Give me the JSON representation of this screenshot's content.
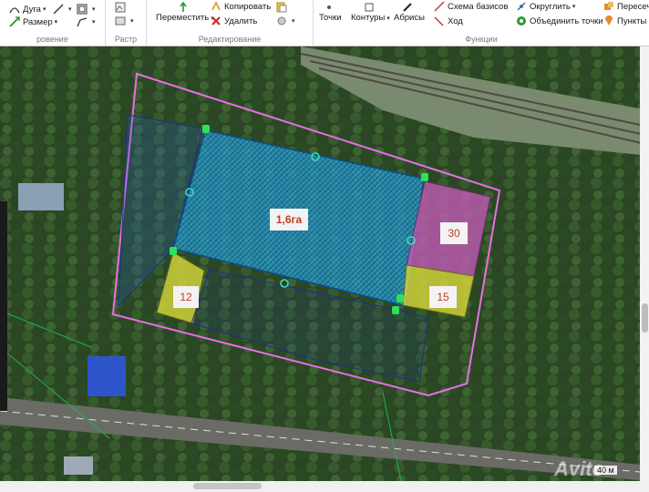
{
  "ribbon": {
    "groups": [
      {
        "title": "ровение"
      },
      {
        "title": "Растр"
      },
      {
        "title": "Редактирование"
      },
      {
        "title": "Функции"
      }
    ],
    "draw": {
      "arc_label": "Дуга",
      "size_label": "Размер"
    },
    "edit": {
      "move_label": "Переместить",
      "copy_label": "Копировать",
      "delete_label": "Удалить"
    },
    "func": {
      "points_label": "Точки",
      "contours_label": "Контуры",
      "abrisy_label": "Абрисы",
      "base_scheme_label": "Схема базисов",
      "course_label": "Ход",
      "round_label": "Округлить",
      "merge_points_label": "Объединить точки",
      "intersect_label": "Пересеч",
      "points_s_label": "Пункты С"
    }
  },
  "map": {
    "main_plot_label": "1,6га",
    "plot_30_label": "30",
    "plot_12_label": "12",
    "plot_15_label": "15",
    "scale_label": "40 м",
    "watermark": "Avito",
    "colors": {
      "boundary": "#e86ee8",
      "main_fill": "#2aa6d8",
      "magenta_fill": "#c05ab4",
      "yellow_fill": "#d8d83a",
      "vertex": "#3be0b8"
    }
  }
}
